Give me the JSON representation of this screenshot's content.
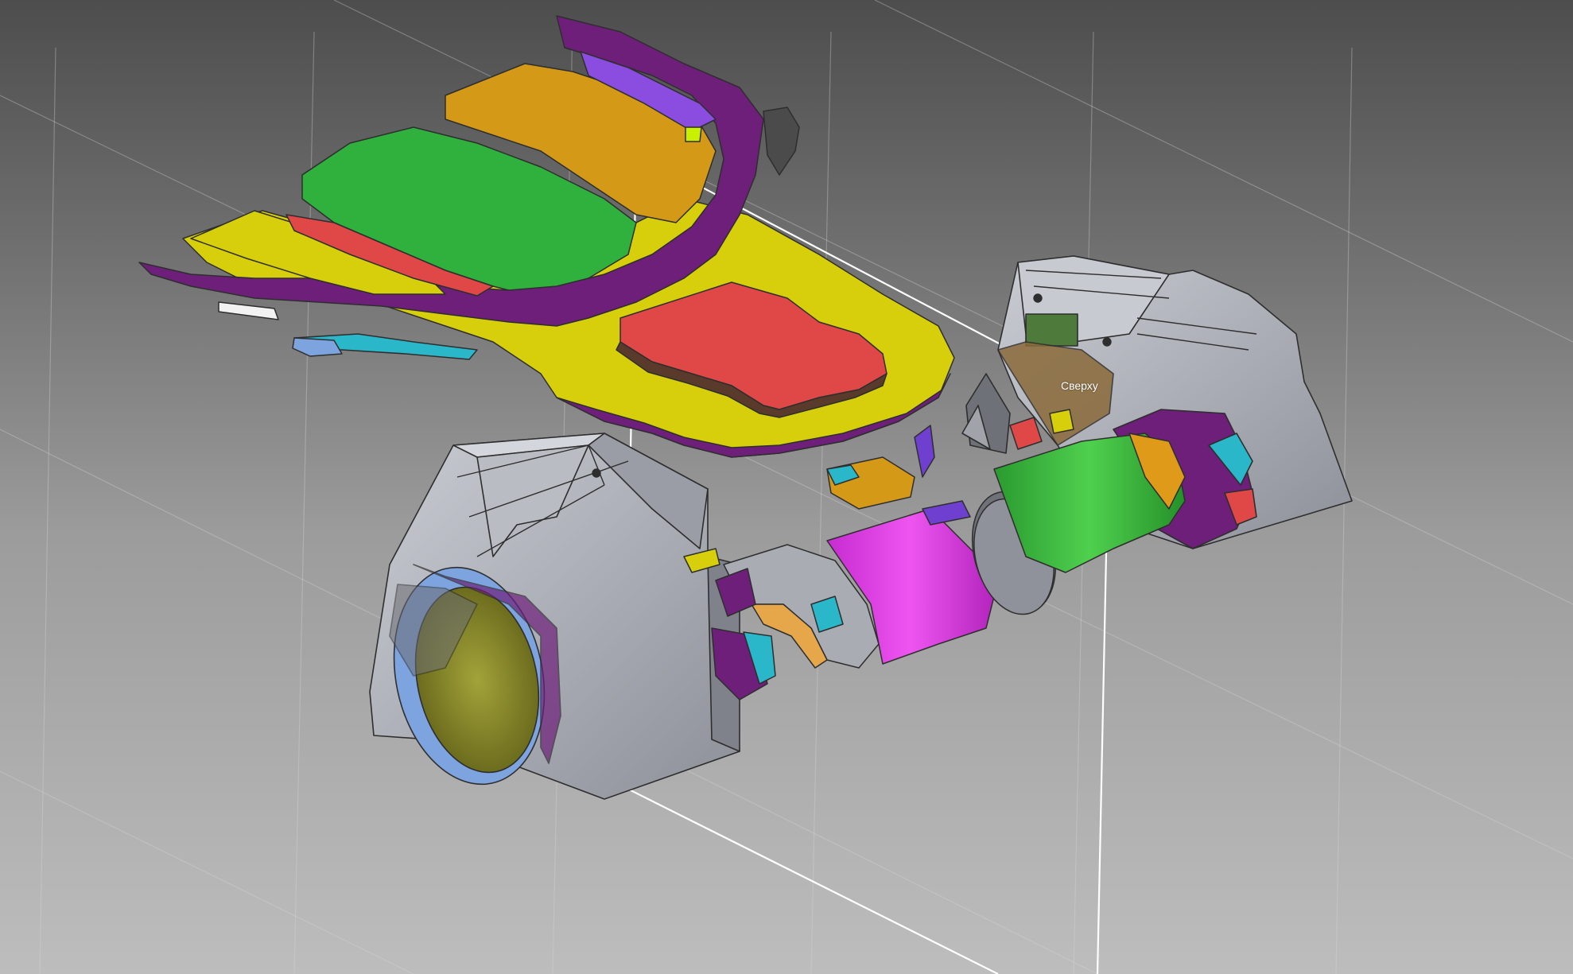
{
  "viewport": {
    "plane_label": "Сверху",
    "background_top": "#4d4d4d",
    "background_bottom": "#bdbdbd"
  },
  "colors": {
    "gray_part": "#b4b7bf",
    "gray_shade": "#8f929a",
    "outline": "#2e2e2e",
    "purple": "#6d1f7a",
    "yellow": "#d7cf0b",
    "orange": "#d49a17",
    "green": "#30b03c",
    "red": "#e04848",
    "magenta": "#e23ee6",
    "cyan": "#2ab7c9",
    "olive": "#8a8a2a",
    "blue_ring": "#7ea4e0"
  },
  "icons": [
    "section-plane-handle-icon"
  ]
}
